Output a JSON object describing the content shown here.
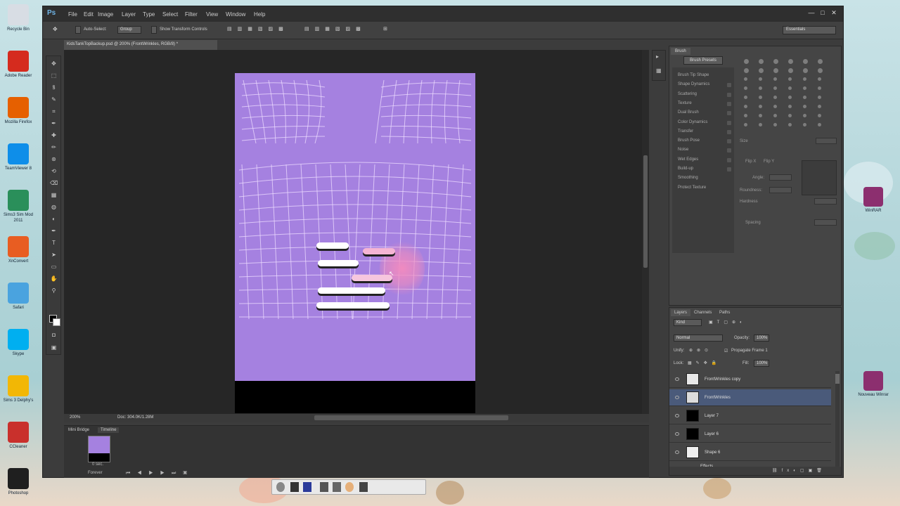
{
  "desktop": {
    "left_icons": [
      {
        "label": "Recycle Bin",
        "icon": "recycle-bin-icon",
        "color": "#d8dde4"
      },
      {
        "label": "Adobe Reader",
        "icon": "adobe-reader-icon",
        "color": "#d52b1e"
      },
      {
        "label": "Mozilla Firefox",
        "icon": "firefox-icon",
        "color": "#e66000"
      },
      {
        "label": "TeamViewer 8",
        "icon": "teamviewer-icon",
        "color": "#0e8ee9"
      },
      {
        "label": "Sims3 Sim Mod 2011",
        "icon": "sims-mod-icon",
        "color": "#2a8f5a"
      },
      {
        "label": "XnConvert",
        "icon": "xnconvert-icon",
        "color": "#e85d22"
      },
      {
        "label": "Safari",
        "icon": "safari-icon",
        "color": "#4aa3df"
      },
      {
        "label": "Skype",
        "icon": "skype-icon",
        "color": "#00aff0"
      },
      {
        "label": "Sims 3 Delphy's",
        "icon": "sims-delphy-icon",
        "color": "#f2b705"
      },
      {
        "label": "CCleaner",
        "icon": "ccleaner-icon",
        "color": "#c9302c"
      },
      {
        "label": "Photoshop",
        "icon": "photoshop-desktop-icon",
        "color": "#1f1f1f"
      }
    ],
    "right_icons": [
      {
        "label": "WinRAR",
        "icon": "winrar-icon",
        "color": "#8c2f6f"
      },
      {
        "label": "Nouveau Winrar",
        "icon": "winrar-archive-icon",
        "color": "#8c2f6f"
      }
    ]
  },
  "app": {
    "logo": "Ps",
    "menu": [
      "File",
      "Edit",
      "Image",
      "Layer",
      "Type",
      "Select",
      "Filter",
      "View",
      "Window",
      "Help"
    ],
    "window_controls": [
      "—",
      "□",
      "✕"
    ],
    "options_bar": {
      "auto_select_label": "Auto-Select:",
      "auto_select_value": "Group",
      "transform_label": "Show Transform Controls",
      "workspace": "Essentials"
    },
    "document_tab": "KidsTankTopBackup.psd @ 200% (FrontWrinkles, RGB/8) *",
    "status": {
      "zoom": "200%",
      "doc_size": "Doc: 304.0K/1.28M"
    },
    "timeline": {
      "tabs": [
        "Mini Bridge",
        "Timeline"
      ],
      "frame_delay": "0 sec.",
      "loop": "Forever"
    }
  },
  "brush_panel": {
    "tab": "Brush",
    "presets_button": "Brush Presets",
    "options": [
      "Brush Tip Shape",
      "Shape Dynamics",
      "Scattering",
      "Texture",
      "Dual Brush",
      "Color Dynamics",
      "Transfer",
      "Brush Pose",
      "Noise",
      "Wet Edges",
      "Build-up",
      "Smoothing",
      "Protect Texture"
    ],
    "labels": {
      "size": "Size",
      "flip_x": "Flip X",
      "flip_y": "Flip Y",
      "angle": "Angle:",
      "roundness": "Roundness:",
      "hardness": "Hardness",
      "spacing": "Spacing"
    }
  },
  "layers_panel": {
    "tabs": [
      "Layers",
      "Channels",
      "Paths"
    ],
    "filter_kind": "Kind",
    "blend_mode": "Normal",
    "opacity_label": "Opacity:",
    "opacity_value": "100%",
    "unify_label": "Unify:",
    "propagate_label": "Propagate Frame 1",
    "lock_label": "Lock:",
    "fill_label": "Fill:",
    "fill_value": "100%",
    "layers": [
      {
        "name": "FrontWrinkles copy",
        "thumb": "#e8e8e8",
        "selected": false
      },
      {
        "name": "FrontWrinkles",
        "thumb": "#dcdcdc",
        "selected": true
      },
      {
        "name": "Layer 7",
        "thumb": "#000000",
        "selected": false
      },
      {
        "name": "Layer 6",
        "thumb": "#000000",
        "selected": false
      },
      {
        "name": "Shape 6",
        "thumb": "#efefef",
        "selected": false
      },
      {
        "name": "Effects",
        "thumb": "",
        "selected": false
      }
    ]
  },
  "colors": {
    "canvas_purple": "#a581e0",
    "selection_blue": "#4a5a7a",
    "accent_pink": "#f08ac0"
  }
}
